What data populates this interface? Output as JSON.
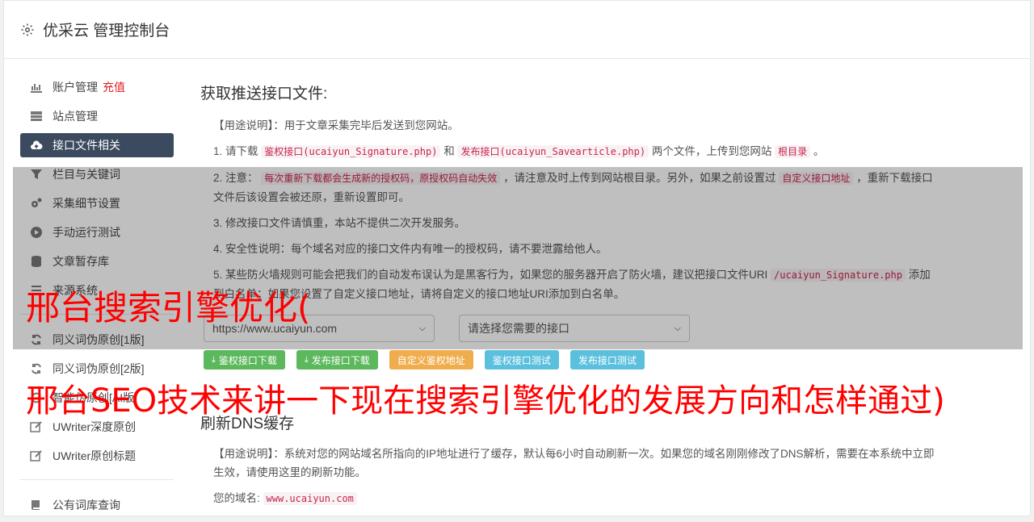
{
  "header": {
    "title": "优采云 管理控制台"
  },
  "sidebar": {
    "items": [
      {
        "label": "账户管理",
        "extra": "充值",
        "icon": "bar-chart-icon"
      },
      {
        "label": "站点管理",
        "icon": "server-icon"
      },
      {
        "label": "接口文件相关",
        "icon": "cloud-upload-icon",
        "active": true
      },
      {
        "label": "栏目与关键词",
        "icon": "filter-icon"
      },
      {
        "label": "采集细节设置",
        "icon": "cogs-icon"
      },
      {
        "label": "手动运行测试",
        "icon": "play-circle-icon"
      },
      {
        "label": "文章暂存库",
        "icon": "database-icon"
      },
      {
        "label": "来源系统",
        "icon": "list-icon"
      }
    ],
    "items2": [
      {
        "label": "同义词伪原创[1版]",
        "icon": "refresh-icon"
      },
      {
        "label": "同义词伪原创[2版]",
        "icon": "refresh-icon"
      },
      {
        "label": "智能伪原创[AI版]",
        "icon": "refresh-icon"
      },
      {
        "label": "UWriter深度原创",
        "icon": "edit-icon"
      },
      {
        "label": "UWriter原创标题",
        "icon": "edit-icon"
      }
    ],
    "items3": [
      {
        "label": "公有词库查询",
        "icon": "book-icon"
      }
    ]
  },
  "main": {
    "section1_title": "获取推送接口文件:",
    "usage": "【用途说明】：用于文章采集完毕后发送到您网站。",
    "step1": {
      "pre": "1. 请下载",
      "code1": "鉴权接口(ucaiyun_Signature.php)",
      "mid": "和",
      "code2": "发布接口(ucaiyun_Savearticle.php)",
      "post": "两个文件，上传到您网站",
      "code3": "根目录",
      "end": "。"
    },
    "step2": {
      "pre": "2. 注意：",
      "code1": "每次重新下载都会生成新的授权码，原授权码自动失效",
      "mid": "，请注意及时上传到网站根目录。另外，如果之前设置过",
      "code2": "自定义接口地址",
      "post": "，重新下载接口文件后该设置会被还原，重新设置即可。"
    },
    "step3": "3. 修改接口文件请慎重，本站不提供二次开发服务。",
    "step4": "4. 安全性说明：每个域名对应的接口文件内有唯一的授权码，请不要泄露给他人。",
    "step5": {
      "pre": "5. 某些防火墙规则可能会把我们的自动发布误认为是黑客行为，如果您的服务器开启了防火墙，建议把接口文件URI",
      "code1": "/ucaiyun_Signature.php",
      "post": "添加到白名单；如果您设置了自定义接口地址，请将自定义的接口地址URI添加到白名单。"
    },
    "select_site": "https://www.ucaiyun.com",
    "select_api_placeholder": "请选择您需要的接口",
    "buttons": {
      "dl_sig": "鉴权接口下载",
      "dl_pub": "发布接口下载",
      "custom": "自定义鉴权地址",
      "test_sig": "鉴权接口测试",
      "test_pub": "发布接口测试"
    },
    "section2_title": "刷新DNS缓存",
    "dns_usage": "【用途说明】：系统对您的网站域名所指向的IP地址进行了缓存，默认每6小时自动刷新一次。如果您的域名刚刚修改了DNS解析，需要在本系统中立即生效，请使用这里的刷新功能。",
    "domain_label": "您的域名:",
    "domain_value": "www.ucaiyun.com"
  },
  "overlay_text": {
    "line1": "邢台搜索引擎优化(",
    "line2": "邢台SEO技术来讲一下现在搜索引擎优化的发展方向和怎样通过)"
  }
}
